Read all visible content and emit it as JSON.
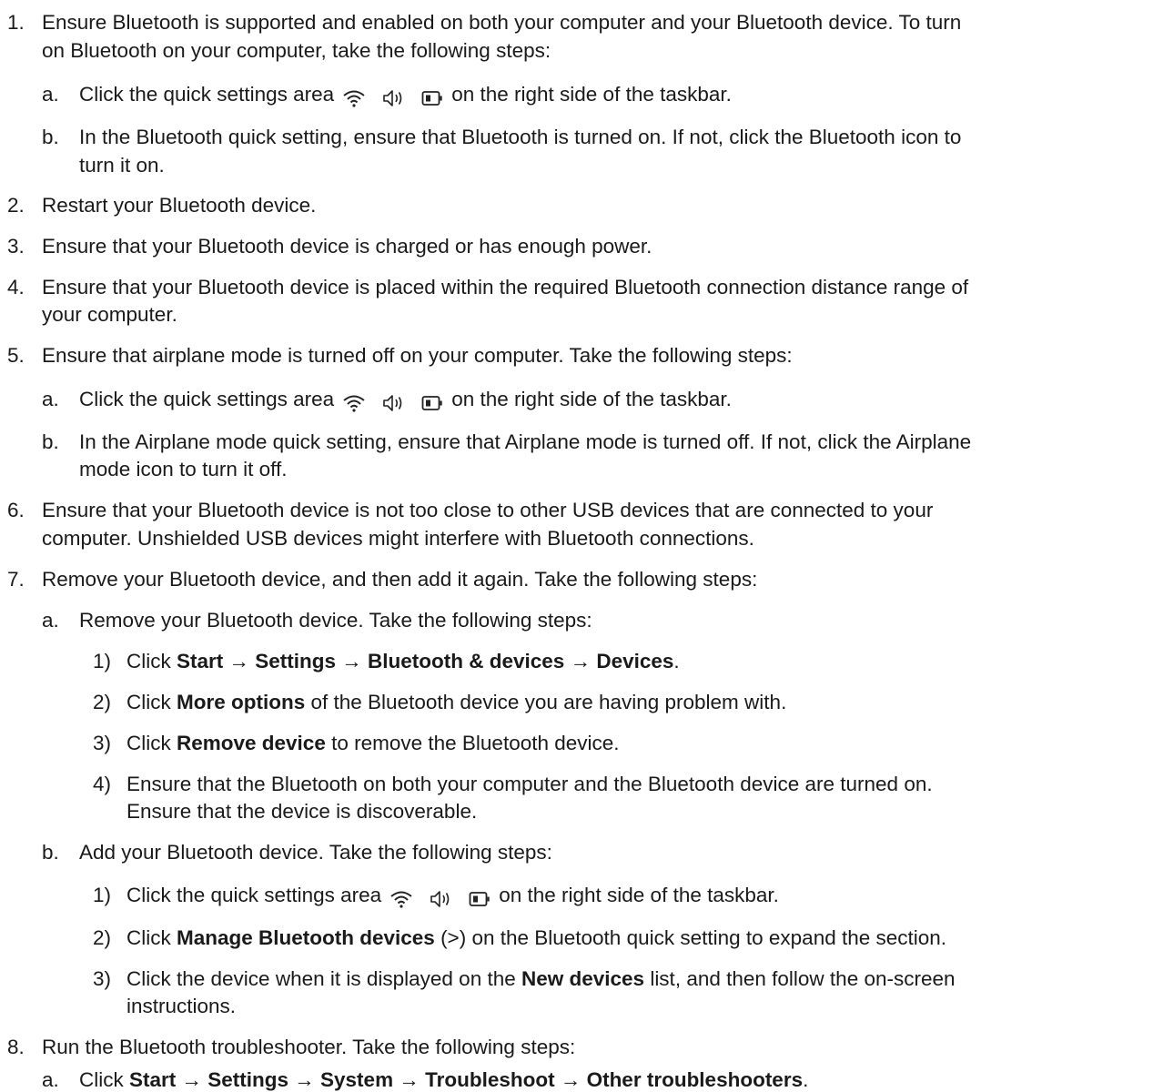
{
  "steps": [
    {
      "marker": "1.",
      "lines": [
        "Ensure Bluetooth is supported and enabled on both your computer and your Bluetooth device. To turn",
        "on Bluetooth on your computer, take the following steps:"
      ],
      "substeps": [
        {
          "marker": "a.",
          "before": "Click the quick settings area",
          "icons": [
            "wifi-icon",
            "volume-icon",
            "battery-icon"
          ],
          "after": "on the right side of the taskbar."
        },
        {
          "marker": "b.",
          "lines": [
            "In the Bluetooth quick setting, ensure that Bluetooth is turned on. If not, click the Bluetooth icon to",
            "turn it on."
          ]
        }
      ]
    },
    {
      "marker": "2.",
      "lines": [
        "Restart your Bluetooth device."
      ]
    },
    {
      "marker": "3.",
      "lines": [
        "Ensure that your Bluetooth device is charged or has enough power."
      ]
    },
    {
      "marker": "4.",
      "lines": [
        "Ensure that your Bluetooth device is placed within the required Bluetooth connection distance range of",
        "your computer."
      ]
    },
    {
      "marker": "5.",
      "lines": [
        "Ensure that airplane mode is turned off on your computer. Take the following steps:"
      ],
      "substeps": [
        {
          "marker": "a.",
          "before": "Click the quick settings area",
          "icons": [
            "wifi-icon",
            "volume-icon",
            "battery-icon"
          ],
          "after": "on the right side of the taskbar."
        },
        {
          "marker": "b.",
          "lines": [
            "In the Airplane mode quick setting, ensure that Airplane mode is turned off. If not, click the Airplane",
            "mode icon to turn it off."
          ]
        }
      ]
    },
    {
      "marker": "6.",
      "lines": [
        "Ensure that your Bluetooth device is not too close to other USB devices that are connected to your",
        "computer. Unshielded USB devices might interfere with Bluetooth connections."
      ]
    },
    {
      "marker": "7.",
      "lines": [
        "Remove your Bluetooth device, and then add it again. Take the following steps:"
      ],
      "substeps": [
        {
          "marker": "a.",
          "lines": [
            "Remove your Bluetooth device. Take the following steps:"
          ],
          "items": [
            {
              "marker": "1)",
              "pre": "Click ",
              "bold": "Start → Settings → Bluetooth & devices → Devices",
              "post": "."
            },
            {
              "marker": "2)",
              "pre": "Click ",
              "bold": "More options",
              "post": " of the Bluetooth device you are having problem with."
            },
            {
              "marker": "3)",
              "pre": "Click ",
              "bold": "Remove device",
              "post": " to remove the Bluetooth device."
            },
            {
              "marker": "4)",
              "lines": [
                "Ensure that the Bluetooth on both your computer and the Bluetooth device are turned on.",
                "Ensure that the device is discoverable."
              ]
            }
          ]
        },
        {
          "marker": "b.",
          "lines": [
            "Add your Bluetooth device. Take the following steps:"
          ],
          "items": [
            {
              "marker": "1)",
              "before": "Click the quick settings area",
              "icons": [
                "wifi-icon",
                "volume-icon",
                "battery-icon"
              ],
              "after": "on the right side of the taskbar."
            },
            {
              "marker": "2)",
              "pre": "Click ",
              "bold": "Manage Bluetooth devices",
              "post": " (>) on the Bluetooth quick setting to expand the section."
            },
            {
              "marker": "3)",
              "pre": "Click the device when it is displayed on the ",
              "bold": "New devices",
              "post": " list, and then follow the on-screen",
              "cont": "instructions."
            }
          ]
        }
      ]
    },
    {
      "marker": "8.",
      "lines": [
        "Run the Bluetooth troubleshooter. Take the following steps:"
      ],
      "substeps": [
        {
          "marker": "a.",
          "pre": "Click ",
          "bold": "Start → Settings → System → Troubleshoot → Other troubleshooters",
          "post": "."
        }
      ]
    }
  ]
}
